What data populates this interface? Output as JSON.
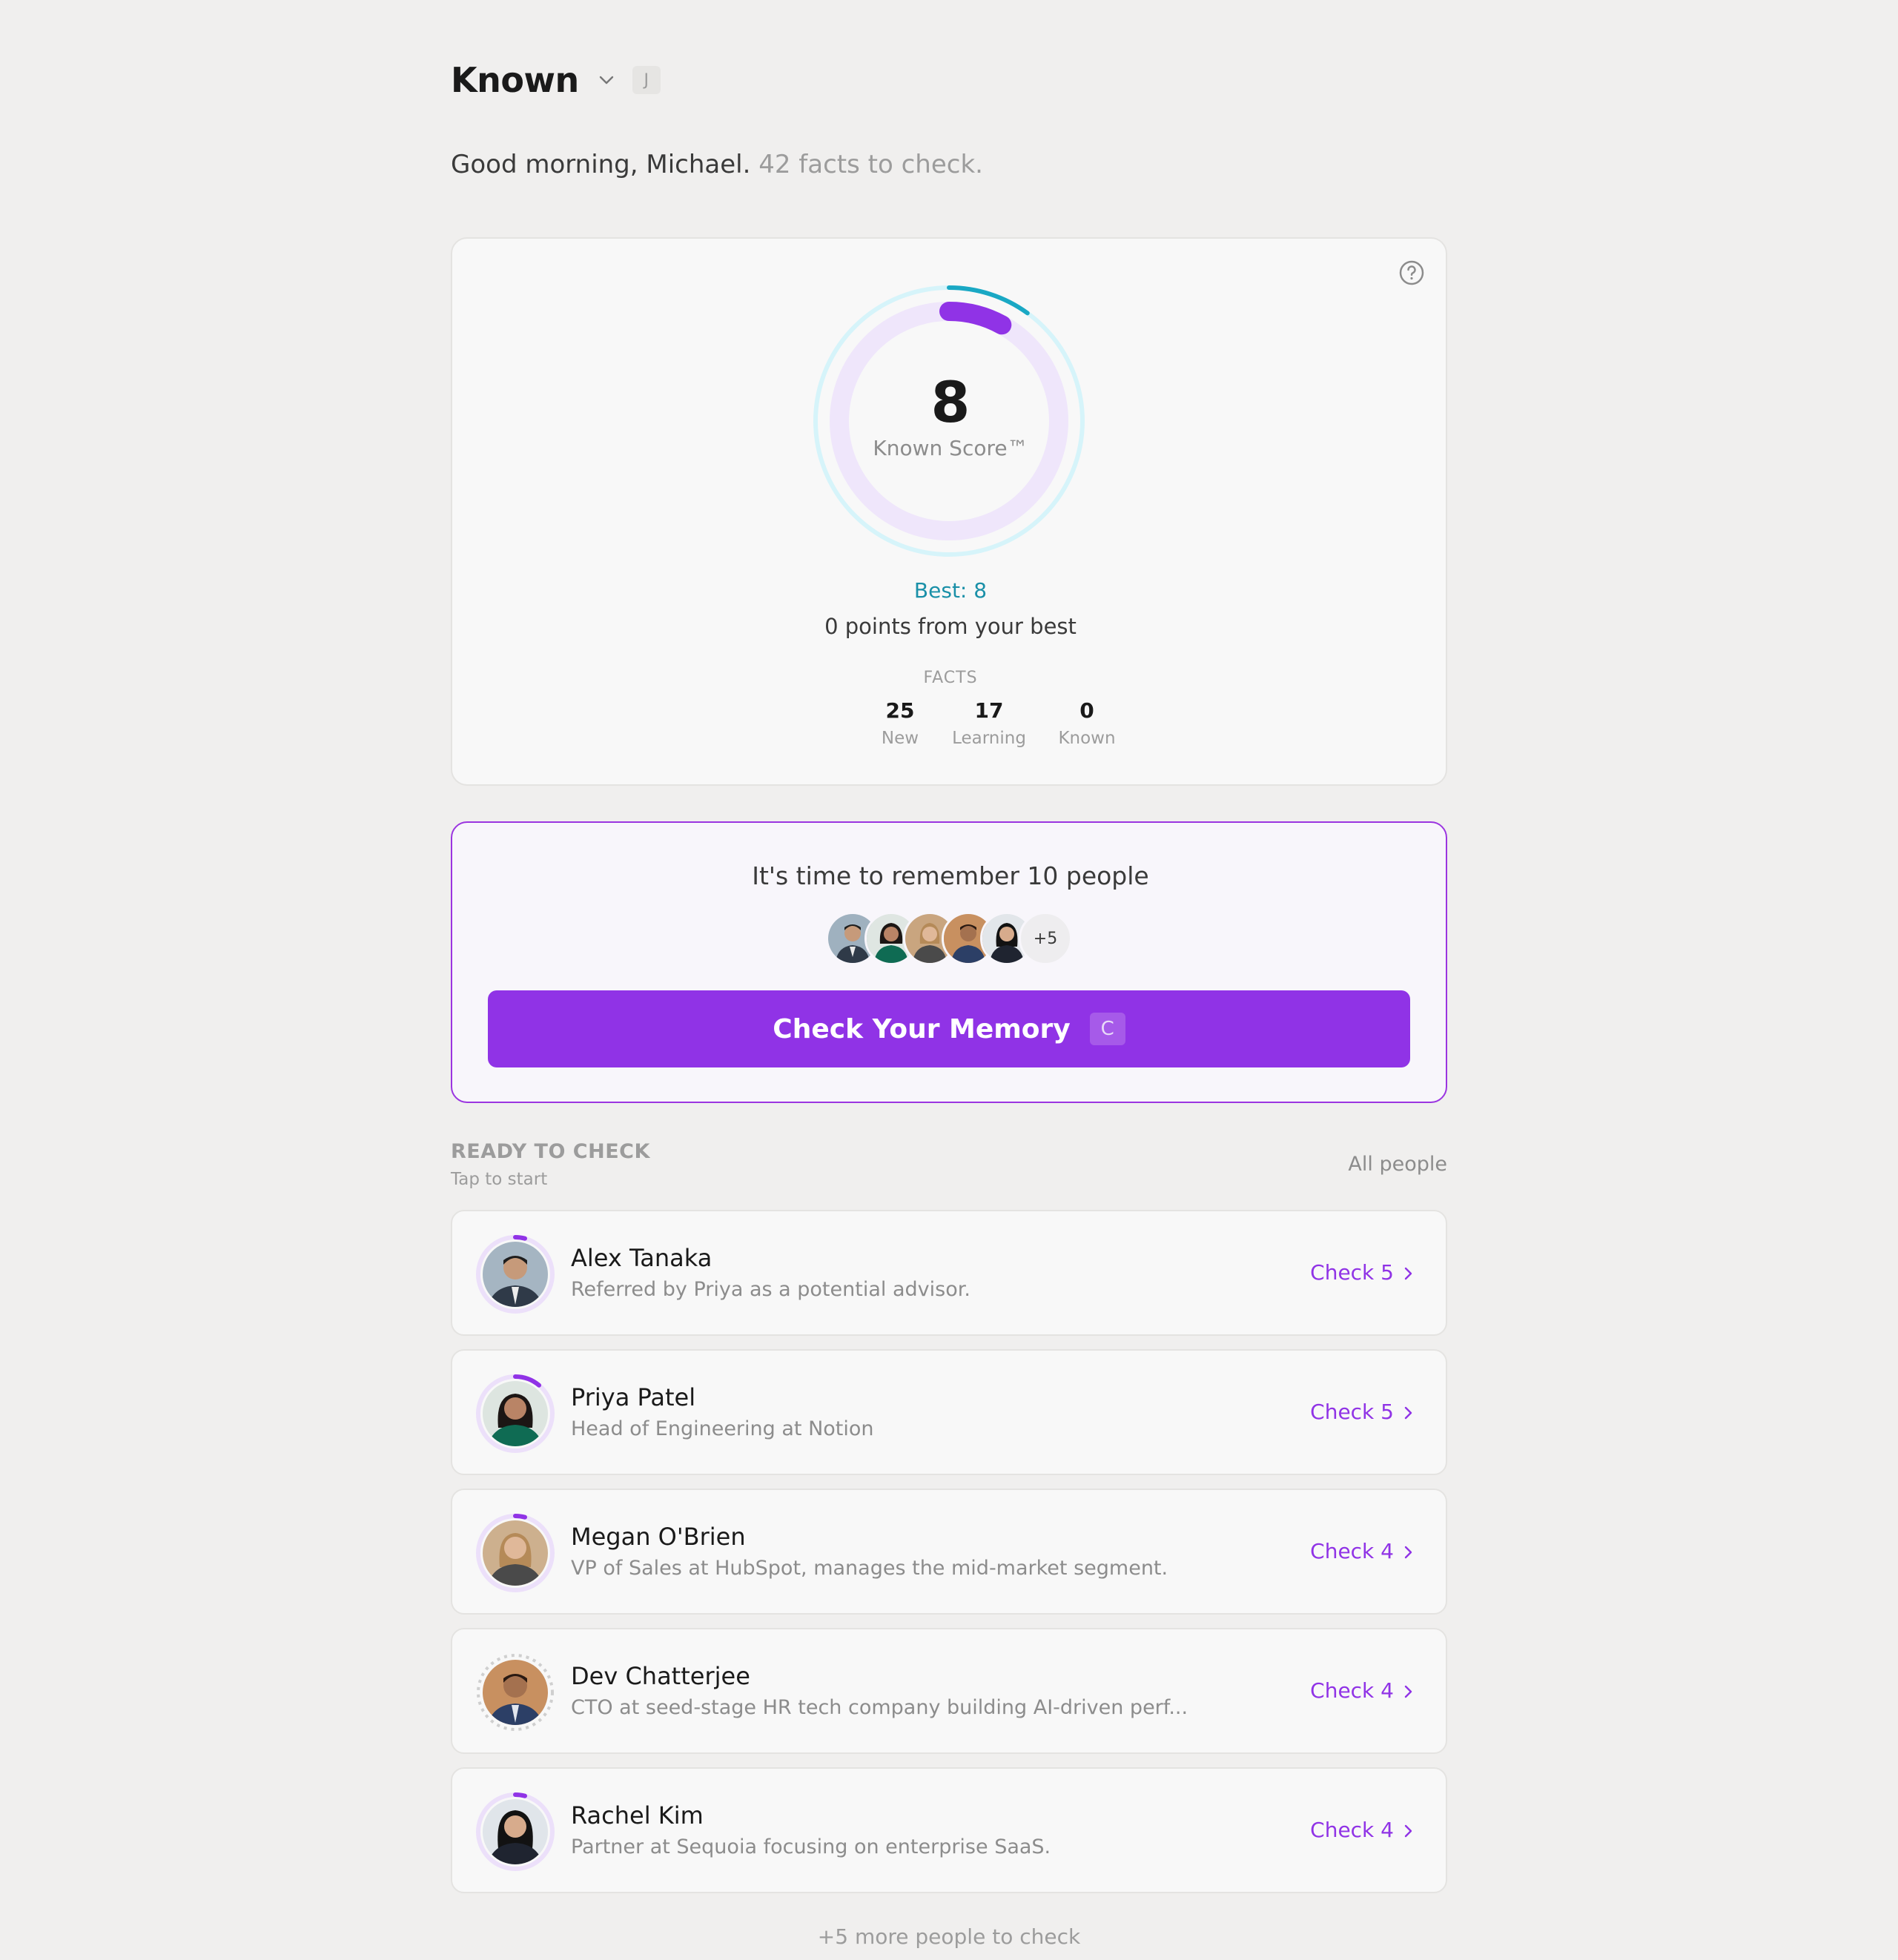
{
  "app": {
    "title": "Known",
    "shortcut": "J"
  },
  "greeting": {
    "main": "Good morning, Michael.",
    "muted": "42 facts to check."
  },
  "score": {
    "value": "8",
    "label": "Known Score™",
    "best": "Best: 8",
    "from_best": "0 points from your best",
    "facts_title": "FACTS",
    "facts": [
      {
        "count": "25",
        "label": "New"
      },
      {
        "count": "17",
        "label": "Learning"
      },
      {
        "count": "0",
        "label": "Known"
      }
    ],
    "colors": {
      "progress": "#9033e6",
      "best": "#1aa8c4",
      "track": "#efe6fb",
      "outer_track": "#d6f4fa"
    }
  },
  "memory": {
    "title": "It's time to remember 10 people",
    "more_badge": "+5",
    "button_label": "Check Your Memory",
    "button_shortcut": "C"
  },
  "ready": {
    "title": "READY TO CHECK",
    "subtitle": "Tap to start",
    "all_people": "All people",
    "people": [
      {
        "name": "Alex Tanaka",
        "desc": "Referred by Priya as a potential advisor.",
        "check": "Check 5"
      },
      {
        "name": "Priya Patel",
        "desc": "Head of Engineering at Notion",
        "check": "Check 5"
      },
      {
        "name": "Megan O'Brien",
        "desc": "VP of Sales at HubSpot, manages the mid-market segment.",
        "check": "Check 4"
      },
      {
        "name": "Dev Chatterjee",
        "desc": "CTO at seed-stage HR tech company building AI-driven perf...",
        "check": "Check 4"
      },
      {
        "name": "Rachel Kim",
        "desc": "Partner at Sequoia focusing on enterprise SaaS.",
        "check": "Check 4"
      }
    ],
    "more_footer": "+5 more people to check"
  },
  "accent": "#9033e6"
}
